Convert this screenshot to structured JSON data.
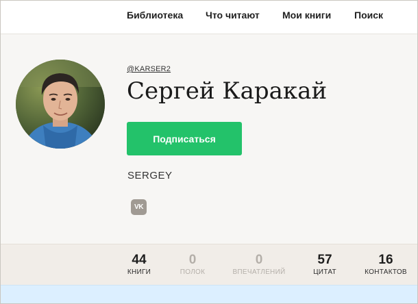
{
  "nav": {
    "items": [
      "Библиотека",
      "Что читают",
      "Мои книги",
      "Поиск"
    ]
  },
  "profile": {
    "handle": "@KARSER2",
    "name": "Сергей Каракай",
    "subscribe_label": "Подписаться",
    "display_name": "SERGEY",
    "social_icon": "vk-icon",
    "social_icon_text": "VK"
  },
  "stats": [
    {
      "value": "44",
      "label": "КНИГИ",
      "active": true
    },
    {
      "value": "0",
      "label": "ПОЛОК",
      "active": false
    },
    {
      "value": "0",
      "label": "ВПЕЧАТЛЕНИЙ",
      "active": false
    },
    {
      "value": "57",
      "label": "ЦИТАТ",
      "active": true
    },
    {
      "value": "16",
      "label": "КОНТАКТОВ",
      "active": true
    }
  ],
  "colors": {
    "accent": "#23c26a",
    "muted": "#b4afa9",
    "background": "#f7f6f4",
    "stats_band": "#f1ede8",
    "bottom_bar": "#dcefff"
  }
}
